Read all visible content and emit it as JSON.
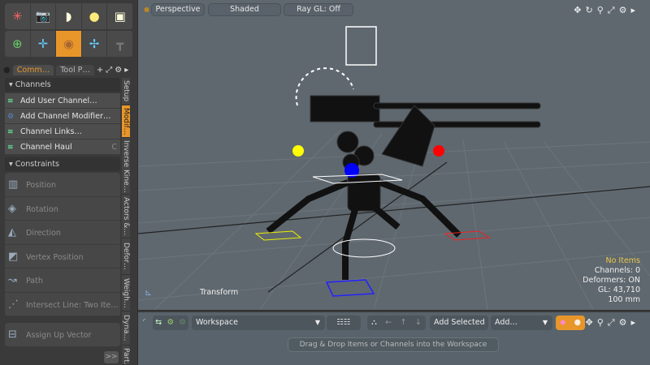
{
  "toolbar_rows": [
    [
      "axis-icon",
      "camera-icon",
      "spotlight-icon",
      "light-bulb-icon",
      "area-light-icon"
    ],
    [
      "transform-gizmo-icon",
      "move-gizmo-icon",
      "element-move-icon",
      "scale-gizmo-icon",
      "rig-icon"
    ]
  ],
  "panel_tabs": [
    "Comm…",
    "Tool P…"
  ],
  "sections": {
    "channels": "Channels",
    "constraints": "Constraints"
  },
  "channel_items": [
    {
      "label": "Add User Channel…",
      "shortcut": ""
    },
    {
      "label": "Add Channel Modifier…",
      "shortcut": ""
    },
    {
      "label": "Channel Links…",
      "shortcut": ""
    },
    {
      "label": "Channel Haul",
      "shortcut": "C"
    }
  ],
  "constraint_items": [
    "Position",
    "Rotation",
    "Direction",
    "Vertex Position",
    "Path",
    "Intersect Line: Two Ite…"
  ],
  "assign_up": "Assign Up Vector",
  "more": ">>",
  "side_tabs": [
    "Setup",
    "Modif…",
    "Inverse Kine…",
    "Actors &…",
    "Defor…",
    "Weigh…",
    "Dyna…",
    "Part…"
  ],
  "viewport": {
    "view": "Perspective",
    "shading": "Shaded",
    "raygl": "Ray GL: Off",
    "tool_label": "Transform",
    "info": {
      "items": "No Items",
      "channels": "Channels: 0",
      "deformers": "Deformers: ON",
      "gl": "GL: 43,710",
      "scale": "100 mm"
    }
  },
  "bottom": {
    "workspace": "Workspace",
    "add_selected": "Add Selected",
    "add": "Add…",
    "hint": "Drag & Drop Items or Channels into the Workspace"
  },
  "colors": {
    "accent": "#e8962a",
    "viewport": "#5f686f"
  }
}
